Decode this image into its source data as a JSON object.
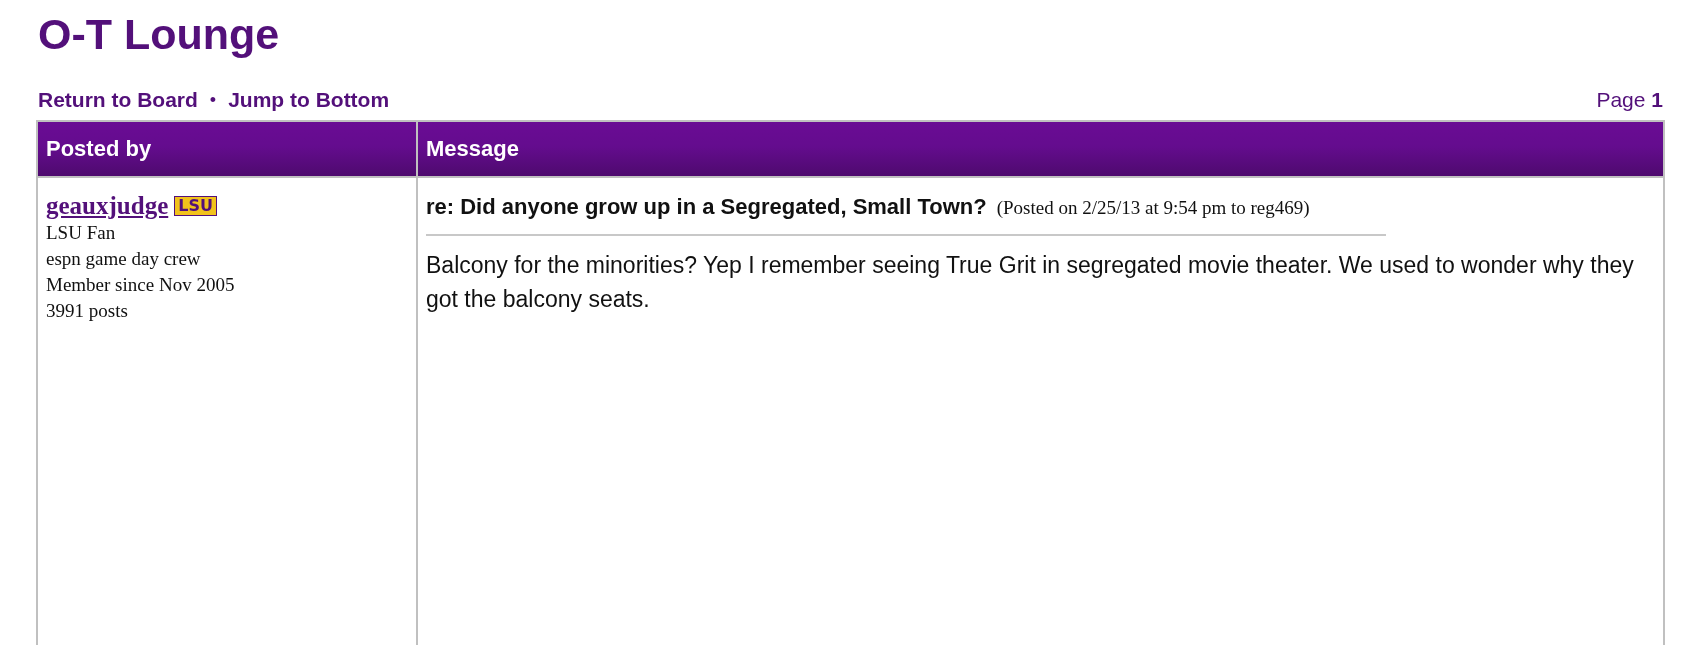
{
  "forum": {
    "title": "O-T Lounge"
  },
  "nav": {
    "links": [
      "Return to Board",
      "Jump to Bottom"
    ],
    "separator": "•",
    "page": "Page **1**"
  },
  "table": {
    "columns": [
      "Posted by",
      "Message"
    ],
    "posts": [
      {
        "author": {
          "name": "geauxjudge",
          "badge": "LSU",
          "details": [
            "LSU Fan",
            "espn game day crew",
            "Member since Nov 2005",
            "3991 posts"
          ]
        },
        "subject": "re: Did anyone grow up in a Segregated, Small Town?",
        "posted": "(Posted on 2/25/13 at 9:54 pm to reg469)",
        "body": "Balcony for the minorities? Yep I remember seeing True Grit in segregated movie theater. We used to wonder why they got the balcony seats."
      }
    ]
  }
}
